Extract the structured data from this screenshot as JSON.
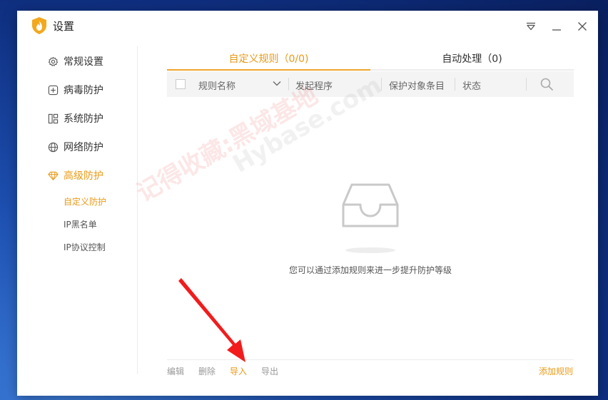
{
  "window": {
    "title": "设置"
  },
  "sidebar": {
    "items": [
      {
        "label": "常规设置",
        "icon": "gear-icon"
      },
      {
        "label": "病毒防护",
        "icon": "plus-square-icon"
      },
      {
        "label": "系统防护",
        "icon": "grid-icon"
      },
      {
        "label": "网络防护",
        "icon": "globe-icon"
      },
      {
        "label": "高级防护",
        "icon": "diamond-icon"
      }
    ],
    "subitems": [
      {
        "label": "自定义防护"
      },
      {
        "label": "IP黑名单"
      },
      {
        "label": "IP协议控制"
      }
    ]
  },
  "tabs": [
    {
      "label": "自定义规则（0/0)"
    },
    {
      "label": "自动处理（0)"
    }
  ],
  "table": {
    "columns": [
      "规则名称",
      "发起程序",
      "保护对象条目",
      "状态"
    ]
  },
  "empty_state": {
    "message": "您可以通过添加规则来进一步提升防护等级"
  },
  "footer": {
    "edit": "编辑",
    "delete": "删除",
    "import": "导入",
    "export": "导出",
    "add_rule": "添加规则"
  },
  "watermark": {
    "text1": "记得收藏:黑域基地",
    "text2": "Hybase.com"
  },
  "colors": {
    "accent": "#e99a17",
    "annotation_arrow": "#f21c1c"
  }
}
